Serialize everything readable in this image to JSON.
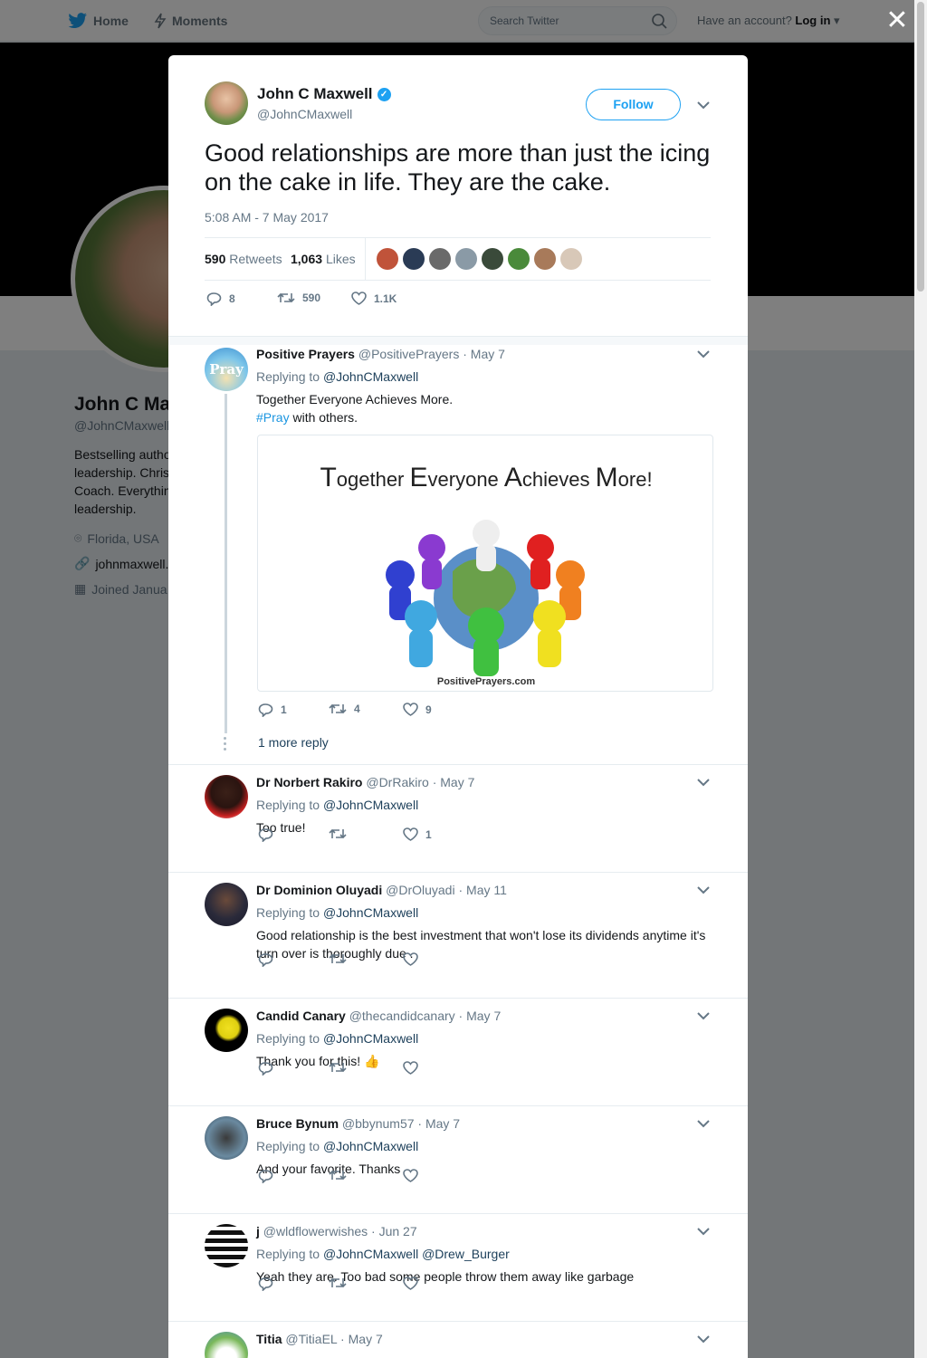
{
  "nav": {
    "home": "Home",
    "moments": "Moments",
    "search_placeholder": "Search Twitter",
    "account_prompt": "Have an account?",
    "login": "Log in"
  },
  "background_profile": {
    "name": "John C Ma",
    "handle": "@JohnCMaxwell",
    "bio": [
      "Bestselling autho",
      "leadership. Chris",
      "Coach. Everythin",
      "leadership."
    ],
    "location": "Florida, USA",
    "website": "johnmaxwell.c",
    "joined": "Joined Janua"
  },
  "close_label": "✕",
  "tweet": {
    "author": "John C Maxwell",
    "handle": "@JohnCMaxwell",
    "follow_label": "Follow",
    "text": "Good relationships are more than just the icing on the cake in life. They are the cake.",
    "timestamp": "5:08 AM - 7 May 2017",
    "retweet_count": "590",
    "retweet_label": "Retweets",
    "like_count": "1,063",
    "like_label": "Likes",
    "actions": {
      "replies": "8",
      "retweets": "590",
      "likes": "1.1K"
    },
    "liker_colors": [
      "#c0533a",
      "#2a3b55",
      "#6a6a6a",
      "#8a9aa6",
      "#3a4a3a",
      "#4a8a3a",
      "#a87a5a",
      "#d8c8b8"
    ]
  },
  "replies": [
    {
      "name": "Positive Prayers",
      "handle": "@PositivePrayers",
      "date": "May 7",
      "replying_to": "Replying to",
      "mentions": "@JohnCMaxwell",
      "text_line1": "Together Everyone Achieves More.",
      "hashtag": "#Pray",
      "text_line2_rest": " with others.",
      "avatar_text": "Pray",
      "card": {
        "title_parts": [
          "T",
          "ogether ",
          "E",
          "veryone ",
          "A",
          "chieves ",
          "M",
          "ore!"
        ],
        "credit": "PositivePrayers.com"
      },
      "actions": {
        "replies": "1",
        "retweets": "4",
        "likes": "9"
      },
      "more_replies": "1 more reply"
    },
    {
      "name": "Dr Norbert Rakiro",
      "handle": "@DrRakiro",
      "date": "May 7",
      "replying_to": "Replying to",
      "mentions": "@JohnCMaxwell",
      "text": "Too true!",
      "actions": {
        "replies": "",
        "retweets": "",
        "likes": "1"
      }
    },
    {
      "name": "Dr Dominion Oluyadi",
      "handle": "@DrOluyadi",
      "date": "May 11",
      "replying_to": "Replying to",
      "mentions": "@JohnCMaxwell",
      "text": "Good relationship is the best investment that won't lose its dividends anytime it's turn over is thoroughly due .",
      "actions": {
        "replies": "",
        "retweets": "",
        "likes": ""
      }
    },
    {
      "name": "Candid Canary",
      "handle": "@thecandidcanary",
      "date": "May 7",
      "replying_to": "Replying to",
      "mentions": "@JohnCMaxwell",
      "text": "Thank you for this! 👍",
      "actions": {
        "replies": "",
        "retweets": "",
        "likes": ""
      }
    },
    {
      "name": "Bruce Bynum",
      "handle": "@bbynum57",
      "date": "May 7",
      "replying_to": "Replying to",
      "mentions": "@JohnCMaxwell",
      "text": "And your favorite. Thanks",
      "actions": {
        "replies": "",
        "retweets": "",
        "likes": ""
      }
    },
    {
      "name": "j",
      "handle": "@wldflowerwishes",
      "date": "Jun 27",
      "replying_to": "Replying to",
      "mentions": "@JohnCMaxwell @Drew_Burger",
      "text": "Yeah they are. Too bad some people throw them away like garbage",
      "actions": {
        "replies": "",
        "retweets": "",
        "likes": ""
      }
    },
    {
      "name": "Titia",
      "handle": "@TitiaEL",
      "date": "May 7"
    }
  ],
  "colors": {
    "accent": "#1da1f2",
    "text": "#14171a",
    "muted": "#657786"
  }
}
